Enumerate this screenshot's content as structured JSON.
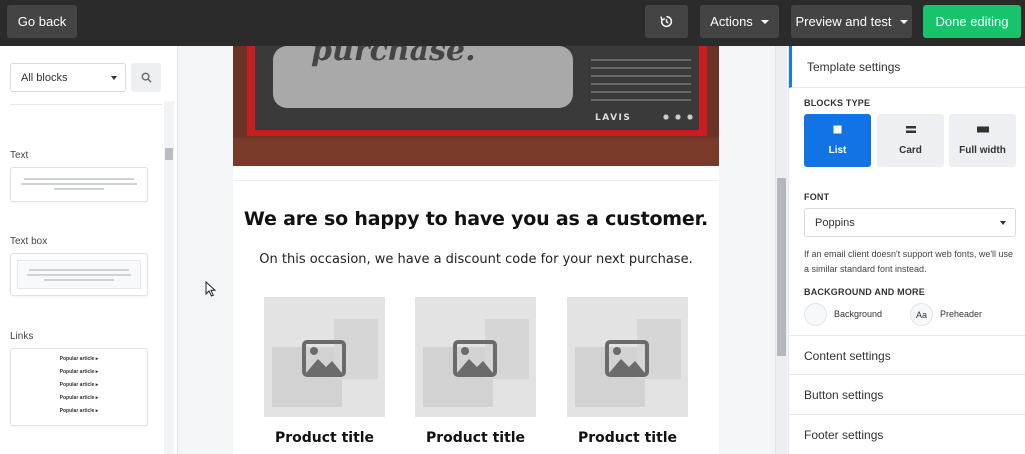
{
  "topbar": {
    "back_label": "Go back",
    "actions_label": "Actions",
    "preview_label": "Preview and test",
    "done_label": "Done editing",
    "history_icon": "history-icon",
    "done_color": "#18c46b"
  },
  "left_panel": {
    "filter_value": "All blocks",
    "search_icon": "search-icon",
    "blocks": [
      {
        "label": "Text"
      },
      {
        "label": "Text box"
      },
      {
        "label": "Links",
        "links": [
          "Popular article ▸",
          "Popular article ▸",
          "Popular article ▸",
          "Popular article ▸",
          "Popular article ▸"
        ]
      }
    ]
  },
  "email": {
    "hero_text": "purchase.",
    "tv_brand": "LAVIS",
    "headline": "We are so happy to have you as a customer.",
    "subline": "On this occasion, we have a discount code for your next purchase.",
    "products": [
      {
        "title": "Product title"
      },
      {
        "title": "Product title"
      },
      {
        "title": "Product title"
      }
    ]
  },
  "right_panel": {
    "header": "Template settings",
    "blocks_type_label": "BLOCKS TYPE",
    "block_types": [
      {
        "label": "List",
        "active": true
      },
      {
        "label": "Card",
        "active": false
      },
      {
        "label": "Full width",
        "active": false
      }
    ],
    "font_label": "FONT",
    "font_value": "Poppins",
    "font_note": "If an email client doesn't support web fonts, we'll use a similar standard font instead.",
    "bg_label": "BACKGROUND AND MORE",
    "background_label": "Background",
    "preheader_icon_text": "Aa",
    "preheader_label": "Preheader",
    "rows": [
      "Content settings",
      "Button settings",
      "Footer settings"
    ],
    "accent_color": "#1273e6"
  }
}
